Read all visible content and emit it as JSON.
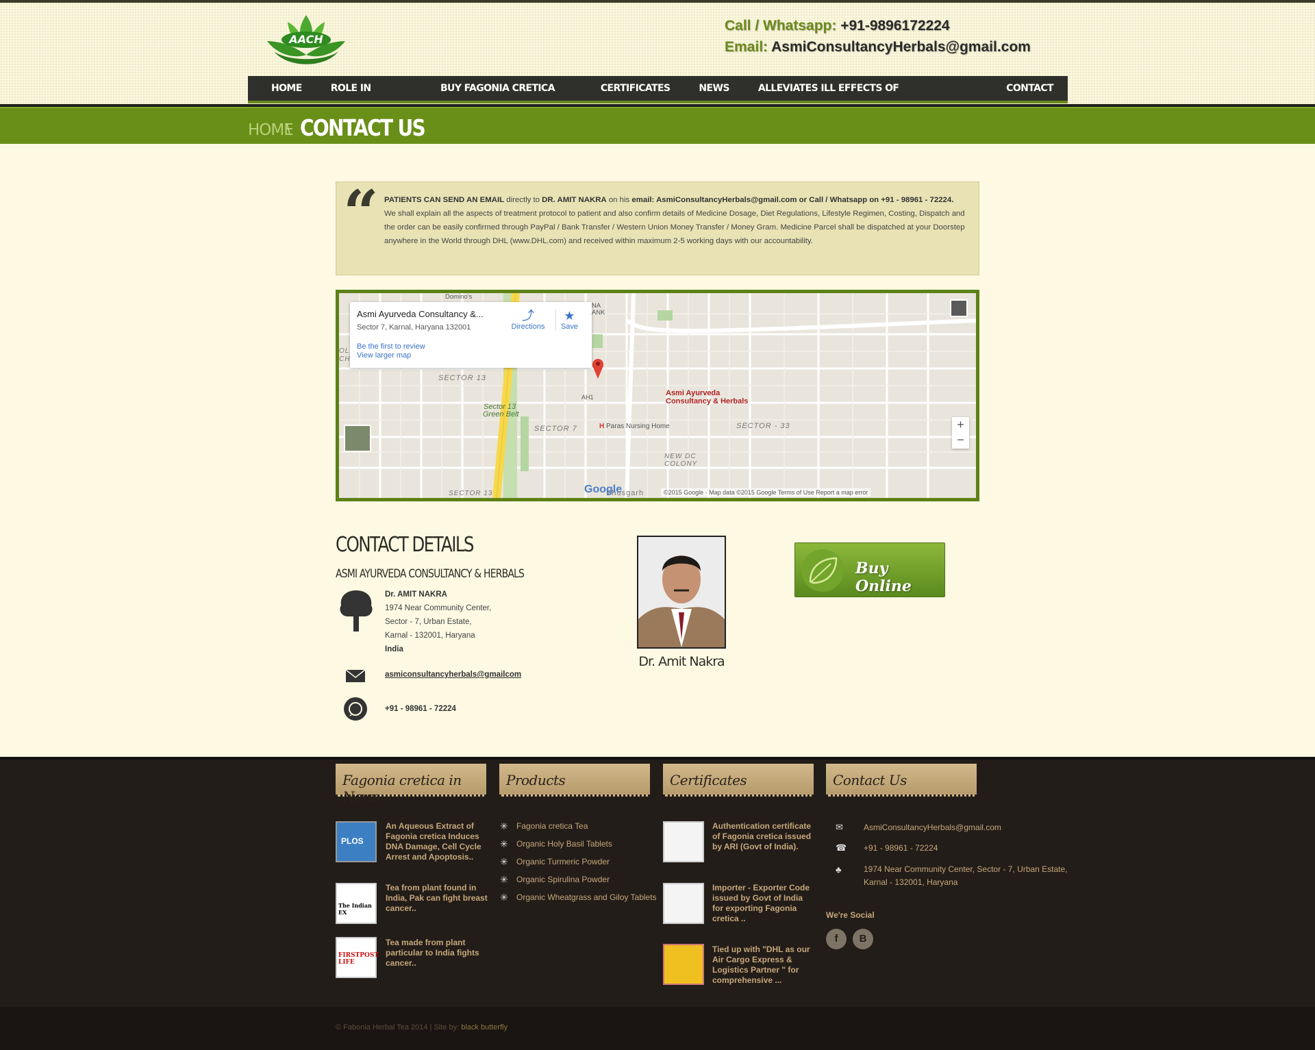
{
  "header": {
    "logo_text": "AACH",
    "call_label": "Call / Whatsapp:",
    "call_value": "+91-9896172224",
    "email_label": "Email:",
    "email_value": "AsmiConsultancyHerbals@gmail.com"
  },
  "nav": [
    "HOME",
    "ROLE IN CANCER",
    "BUY FAGONIA CRETICA TEA",
    "CERTIFICATES",
    "NEWS",
    "ALLEVIATES ILL EFFECTS OF CHEMOTHERAPY",
    "CONTACT US"
  ],
  "breadcrumb": {
    "home": "HOME",
    "separator": "\\",
    "current": "CONTACT US"
  },
  "quote": {
    "lead": "PATIENTS CAN SEND AN EMAIL",
    "t1": " directly to ",
    "doctor": "DR. AMIT NAKRA",
    "t2": " on his ",
    "email_part": "email: AsmiConsultancyHerbals@gmail.com or Call / Whatsapp on +91 - 98961 - 72224.",
    "rest": " We shall explain all the aspects of treatment protocol to patient and also confirm details of Medicine Dosage, Diet Regulations, Lifestyle Regimen, Costing, Dispatch and the order can be easily confirmed through PayPal / Bank Transfer / Western Union Money Transfer / Money Gram. Medicine Parcel shall be dispatched at your Doorstep anywhere in the World through DHL (www.DHL.com) and received within maximum 2-5 working days with our accountability."
  },
  "map": {
    "card_title": "Asmi Ayurveda Consultancy &...",
    "card_address": "Sector 7, Karnal, Haryana 132001",
    "directions": "Directions",
    "save": "Save",
    "review_link": "Be the first to review",
    "larger_link": "View larger map",
    "pin_label_1": "Asmi Ayurveda",
    "pin_label_2": "Consultancy & Herbals",
    "labels": {
      "sector13": "SECTOR 13",
      "sector13_green": "Sector 13",
      "green_belt": "Green Belt",
      "sector7": "SECTOR 7",
      "sector33": "SECTOR - 33",
      "newdc": "NEW DC",
      "colony": "COLONY",
      "paras": "Paras Nursing Home",
      "haryana": "HARYANA",
      "gramin": "GRAMIN BANK",
      "dominos": "Domino's",
      "ah1": "AH1",
      "old_chan": "OLD CHAN",
      "chaman": "CHAMAN",
      "sector13_bottom": "SECTOR 13",
      "bhusgarh": "Bhusgarh"
    },
    "google": "Google",
    "footer": "©2015 Google · Map data ©2015 Google     Terms of Use     Report a map error",
    "zoom_in": "+",
    "zoom_out": "−"
  },
  "contact": {
    "title": "CONTACT DETAILS",
    "company": "ASMI AYURVEDA CONSULTANCY & HERBALS",
    "name": "Dr. AMIT NAKRA",
    "addr1": "1974 Near Community Center,",
    "addr2": "Sector - 7, Urban Estate,",
    "addr3": "Karnal - 132001, Haryana",
    "country": "India",
    "email": "asmiconsultancyherbals@gmailcom",
    "phone": "+91 - 98961 - 72224",
    "photo_caption": "Dr. Amit Nakra",
    "buy_label": "Buy Online"
  },
  "footer": {
    "tabs": [
      "Fagonia cretica in News",
      "Products",
      "Certificates",
      "Contact Us"
    ],
    "news": [
      {
        "thumb": "PLOS",
        "text": "An Aqueous Extract of Fagonia cretica Induces DNA Damage, Cell Cycle Arrest and Apoptosis.."
      },
      {
        "thumb": "The Indian EX",
        "text": "Tea from plant found in India, Pak can fight breast cancer.."
      },
      {
        "thumb": "FIRSTPOST LIFE",
        "text": "Tea made from plant particular to India fights cancer.."
      }
    ],
    "products": [
      "Fagonia cretica Tea",
      "Organic Holy Basil Tablets",
      "Organic Turmeric Powder",
      "Organic Spirulina Powder",
      "Organic Wheatgrass and Giloy Tablets"
    ],
    "certs": [
      "Authentication certificate of Fagonia cretica issued by ARI (Govt of India).",
      "Importer - Exporter Code issued by Govt of India for exporting Fagonia cretica ..",
      "Tied up with \"DHL as our Air Cargo Express & Logistics Partner \" for comprehensive ..."
    ],
    "contact_email": "AsmiConsultancyHerbals@gmail.com",
    "contact_phone": "+91 - 98961 - 72224",
    "contact_addr1": "1974 Near Community Center, Sector - 7, Urban Estate,",
    "contact_addr2": "Karnal - 132001, Haryana",
    "social_heading": "We're Social",
    "social": [
      "f",
      "B"
    ]
  },
  "copyright": {
    "text": "© Fabonia Herbal Tea 2014 | Site by: ",
    "link": "black butterfly"
  },
  "colors": {
    "green": "#6a8f18",
    "dark": "#2f2f2b",
    "footer": "#231d19",
    "cream": "#fdf9e3"
  }
}
